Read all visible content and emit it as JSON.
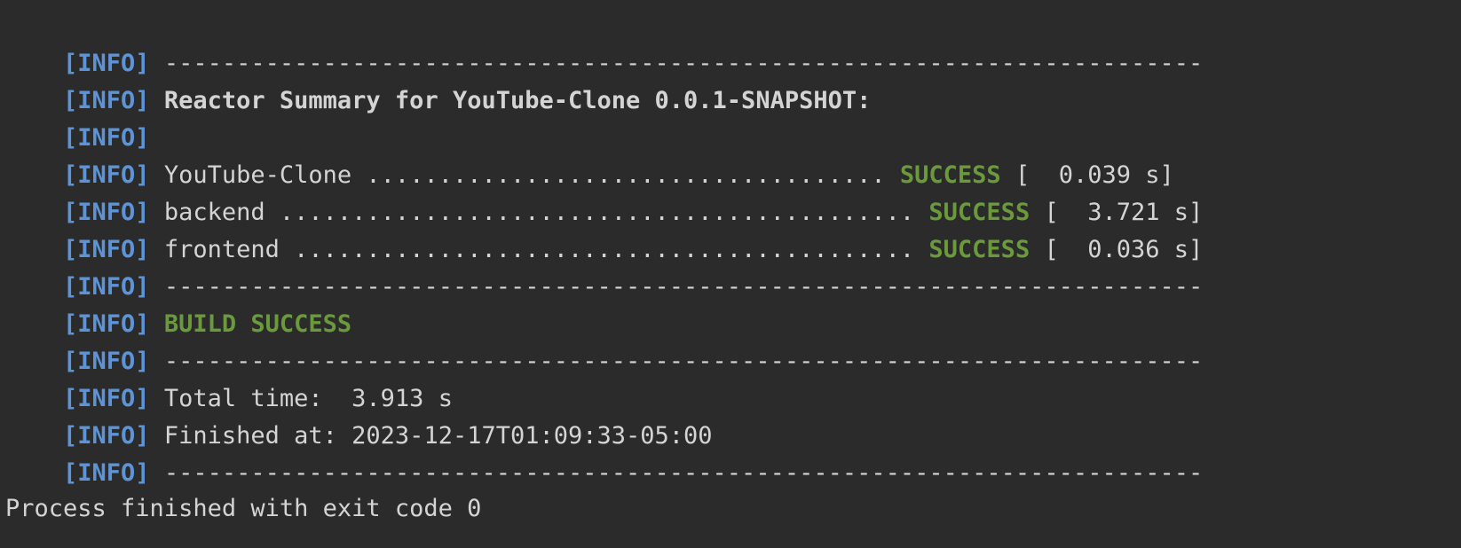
{
  "console": {
    "info_prefix": "[INFO]",
    "separator": "------------------------------------------------------------------------",
    "summary_title": "Reactor Summary for YouTube-Clone 0.0.1-SNAPSHOT:",
    "modules": [
      {
        "name": "YouTube-Clone ",
        "dots": "....................................",
        "status": "SUCCESS",
        "time": " [  0.039 s]"
      },
      {
        "name": "backend ",
        "dots": "............................................",
        "status": "SUCCESS",
        "time": " [  3.721 s]"
      },
      {
        "name": "frontend ",
        "dots": "...........................................",
        "status": "SUCCESS",
        "time": " [  0.036 s]"
      }
    ],
    "build_result": "BUILD SUCCESS",
    "total_time": "Total time:  3.913 s",
    "finished_at": "Finished at: 2023-12-17T01:09:33-05:00",
    "process_exit": "Process finished with exit code 0"
  },
  "colors": {
    "background": "#2b2b2b",
    "info": "#5d94d8",
    "success": "#6a9a3c",
    "text": "#d4d4d4"
  }
}
